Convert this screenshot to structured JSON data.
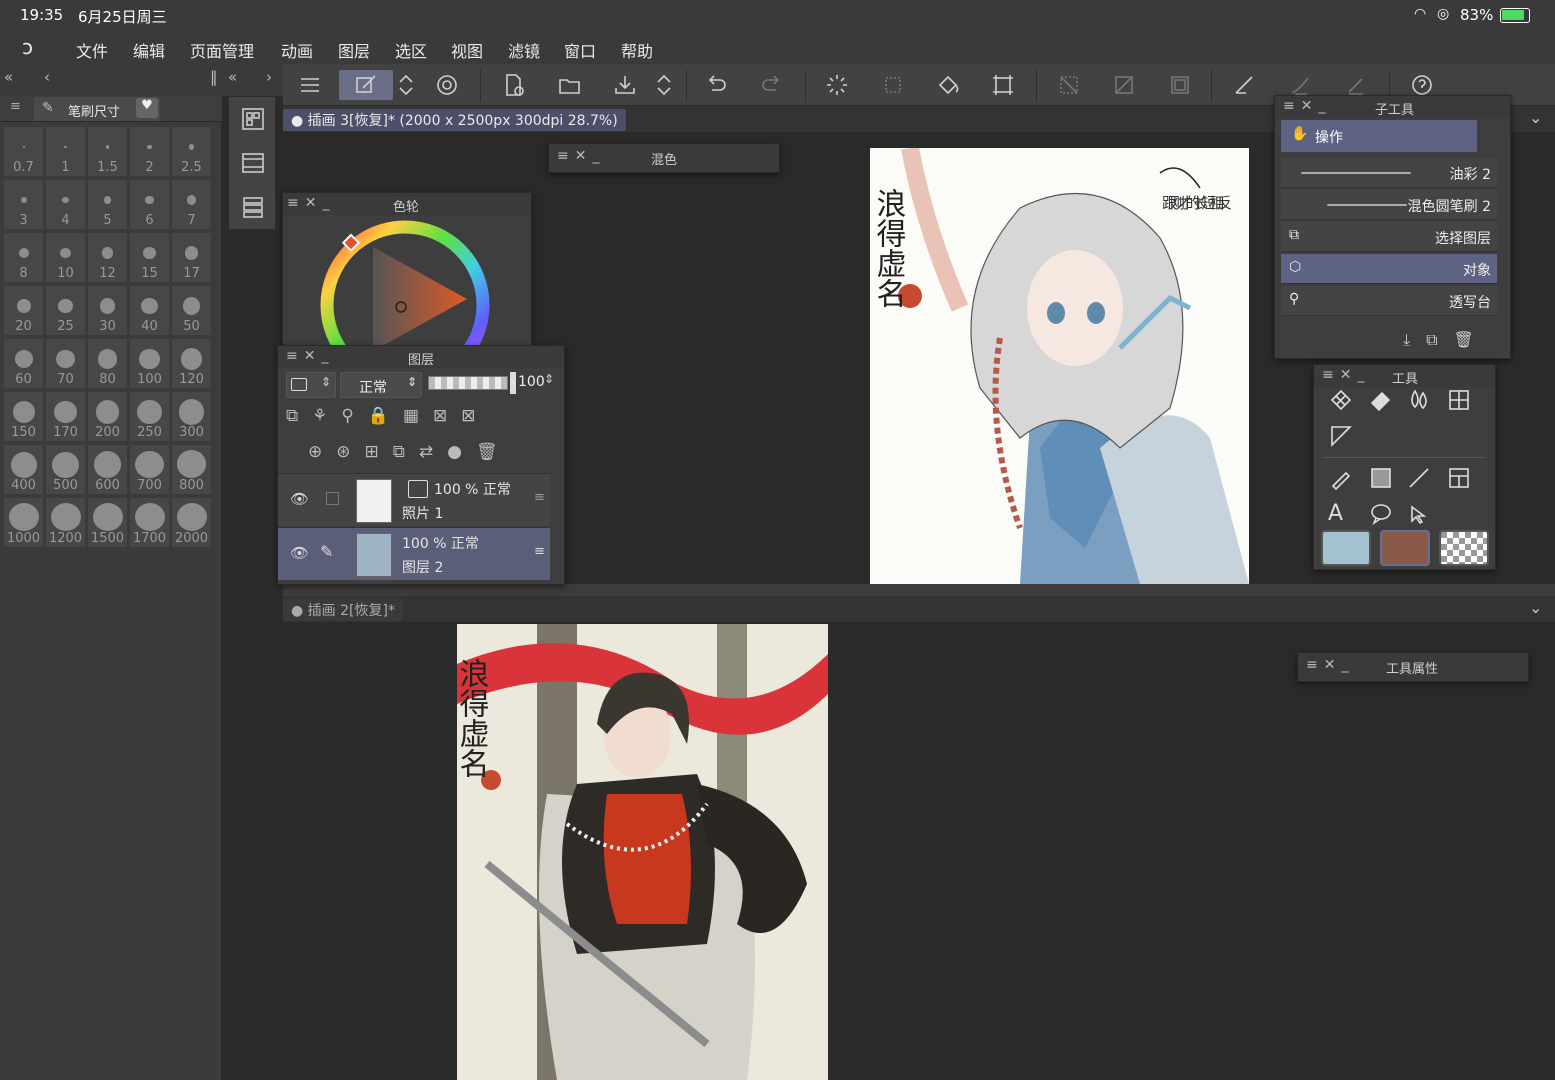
{
  "status": {
    "time": "19:35",
    "date": "6月25日周三",
    "battery": "83%"
  },
  "menu": [
    "文件",
    "编辑",
    "页面管理",
    "动画",
    "图层",
    "选区",
    "视图",
    "滤镜",
    "窗口",
    "帮助"
  ],
  "brush_panel": {
    "title": "笔刷尺寸",
    "sizes": [
      "0.7",
      "1",
      "1.5",
      "2",
      "2.5",
      "3",
      "4",
      "5",
      "6",
      "7",
      "8",
      "10",
      "12",
      "15",
      "17",
      "20",
      "25",
      "30",
      "40",
      "50",
      "60",
      "70",
      "80",
      "100",
      "120",
      "150",
      "170",
      "200",
      "250",
      "300",
      "400",
      "500",
      "600",
      "700",
      "800",
      "1000",
      "1200",
      "1500",
      "1700",
      "2000"
    ]
  },
  "doc1": {
    "tab": "插画 3[恢复]* (2000 x 2500px 300dpi 28.7%)"
  },
  "doc2": {
    "tab": "插画 2[恢复]*"
  },
  "panels": {
    "blend": "混色",
    "color_wheel": "色轮",
    "layers": "图层",
    "subtool": "子工具",
    "tool": "工具",
    "tool_property": "工具属性"
  },
  "layer_panel": {
    "blend_mode": "正常",
    "opacity": "100",
    "layers": [
      {
        "opacity_mode": "100 % 正常",
        "name": "照片 1"
      },
      {
        "opacity_mode": "100 % 正常",
        "name": "图层 2"
      }
    ]
  },
  "subtools": {
    "header": "操作",
    "items": [
      "油彩 2",
      "混色圆笔刷 2",
      "选择图层",
      "对象",
      "透写台"
    ]
  },
  "colors": {
    "main": "#a2c2cf",
    "sub": "#8a5a48",
    "accent": "#5f6383",
    "hue_marker": "#e0502a"
  },
  "artwork": {
    "doc1_calligraphy": "浪得虚名",
    "doc1_note": "跟刚才的长短相反",
    "doc2_calligraphy": "浪得虚名"
  }
}
